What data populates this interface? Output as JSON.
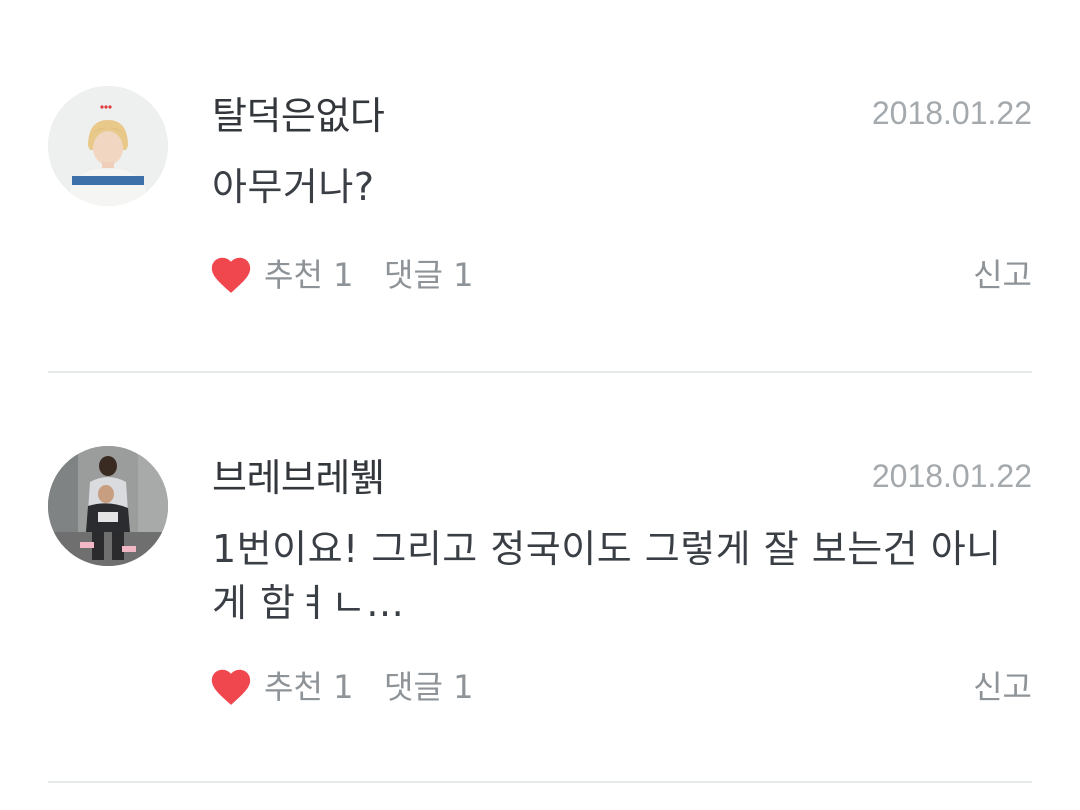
{
  "comments": [
    {
      "username": "탈덕은없다",
      "date": "2018.01.22",
      "text": "아무거나?",
      "recommend_label": "추천",
      "recommend_count": "1",
      "reply_label": "댓글",
      "reply_count": "1",
      "report_label": "신고",
      "avatar_icon": "user-avatar-blonde-portrait"
    },
    {
      "username": "브레브레뷁",
      "date": "2018.01.22",
      "text": "1번이요! 그리고 정국이도 그렇게 잘 보는건 아니게 함ㅕㄴ...",
      "recommend_label": "추천",
      "recommend_count": "1",
      "reply_label": "댓글",
      "reply_count": "1",
      "report_label": "신고",
      "avatar_icon": "user-avatar-piggyback-photo"
    }
  ],
  "colors": {
    "heart": "#f0474f",
    "divider": "#e6e9ea",
    "meta_text": "#8e9398",
    "date_text": "#a4a9ad"
  }
}
